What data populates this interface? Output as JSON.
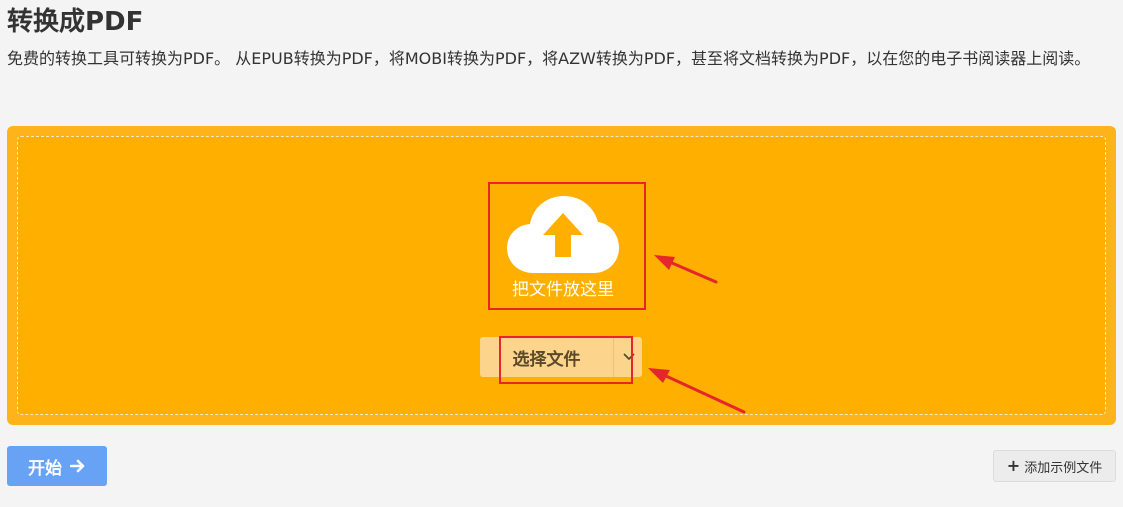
{
  "header": {
    "title": "转换成PDF",
    "description": "免费的转换工具可转换为PDF。 从EPUB转换为PDF，将MOBI转换为PDF，将AZW转换为PDF，甚至将文档转换为PDF，以在您的电子书阅读器上阅读。"
  },
  "dropzone": {
    "icon": "cloud-upload-icon",
    "label": "把文件放这里",
    "choose_label": "选择文件",
    "caret_icon": "chevron-down-icon"
  },
  "actions": {
    "start_label": "开始",
    "start_icon": "arrow-right-icon",
    "sample_label": "添加示例文件",
    "sample_icon": "plus-icon"
  },
  "colors": {
    "dropzone_bg": "#ffaf00",
    "annotation_red": "#e5262b",
    "start_blue": "#5c9cf5"
  }
}
